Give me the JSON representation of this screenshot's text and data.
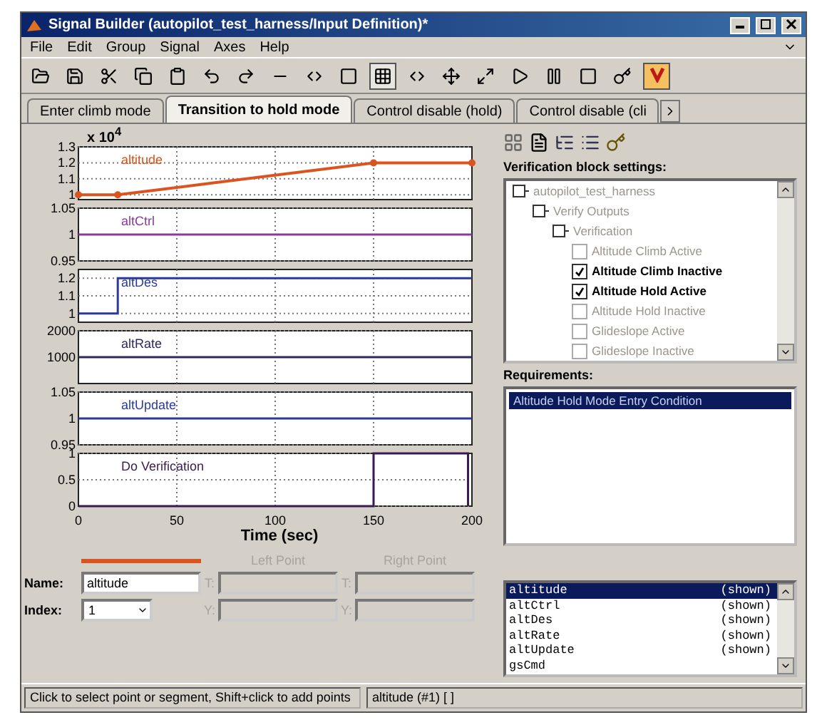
{
  "window": {
    "title": "Signal Builder (autopilot_test_harness/Input Definition)*"
  },
  "menu": [
    "File",
    "Edit",
    "Group",
    "Signal",
    "Axes",
    "Help"
  ],
  "tabs": [
    {
      "label": "Enter climb mode",
      "selected": false
    },
    {
      "label": "Transition to hold mode",
      "selected": true
    },
    {
      "label": "Control disable (hold)",
      "selected": false
    },
    {
      "label": "Control disable (cli",
      "selected": false
    }
  ],
  "plots": {
    "exponent": "x 10$^{4}$",
    "axes": [
      {
        "chart_data": {
          "type": "line",
          "grid": true,
          "xlim": [
            0,
            200
          ],
          "ylim": [
            0.97,
            1.3
          ],
          "yticks": [
            1,
            1.1,
            1.2,
            1.3
          ],
          "x": [
            0,
            20,
            150,
            200
          ],
          "series": [
            {
              "name": "altitude",
              "color": "#d9541e",
              "marker": true,
              "values": [
                1,
                1,
                1.2,
                1.2
              ]
            }
          ]
        }
      },
      {
        "chart_data": {
          "type": "line",
          "grid": true,
          "xlim": [
            0,
            200
          ],
          "ylim": [
            0.95,
            1.05
          ],
          "yticks": [
            0.95,
            1,
            1.05
          ],
          "x": [
            0,
            200
          ],
          "series": [
            {
              "name": "altCtrl",
              "color": "#8a3a9a",
              "values": [
                1,
                1
              ]
            }
          ]
        }
      },
      {
        "chart_data": {
          "type": "line",
          "grid": true,
          "xlim": [
            0,
            200
          ],
          "ylim": [
            0.95,
            1.25
          ],
          "yticks": [
            1,
            1.1,
            1.2
          ],
          "x": [
            0,
            20,
            20,
            200
          ],
          "series": [
            {
              "name": "altDes",
              "color": "#2a3a9a",
              "values": [
                1,
                1,
                1.2,
                1.2
              ]
            }
          ]
        }
      },
      {
        "chart_data": {
          "type": "line",
          "grid": true,
          "xlim": [
            0,
            200
          ],
          "ylim": [
            0,
            2000
          ],
          "yticks": [
            1000,
            2000
          ],
          "x": [
            0,
            200
          ],
          "series": [
            {
              "name": "altRate",
              "color": "#2a2a60",
              "values": [
                1000,
                1000
              ]
            }
          ]
        }
      },
      {
        "chart_data": {
          "type": "line",
          "grid": true,
          "xlim": [
            0,
            200
          ],
          "ylim": [
            0.95,
            1.05
          ],
          "yticks": [
            0.95,
            1,
            1.05
          ],
          "x": [
            0,
            200
          ],
          "series": [
            {
              "name": "altUpdate",
              "color": "#2a3aa0",
              "values": [
                1,
                1
              ]
            }
          ]
        }
      },
      {
        "chart_data": {
          "type": "line",
          "grid": true,
          "xlim": [
            0,
            200
          ],
          "ylim": [
            0,
            1
          ],
          "yticks": [
            0,
            0.5,
            1
          ],
          "xticks": [
            0,
            50,
            100,
            150,
            200
          ],
          "xlabel": "Time (sec)",
          "x": [
            0,
            150,
            150,
            198,
            198
          ],
          "series": [
            {
              "name": "Do Verification",
              "color": "#3a1a50",
              "values": [
                0,
                0,
                1,
                1,
                0
              ]
            }
          ]
        }
      }
    ]
  },
  "signal_editor": {
    "left_point": "Left Point",
    "right_point": "Right Point",
    "name_label": "Name:",
    "name": "altitude",
    "index_label": "Index:",
    "index": "1",
    "left_fields": [
      "T:",
      "Y:"
    ],
    "right_fields": [
      "T:",
      "Y:"
    ]
  },
  "verification": {
    "title": "Verification block settings:",
    "tree": [
      {
        "label": "autopilot_test_harness",
        "kind": "block",
        "children": [
          {
            "label": "Verify Outputs",
            "kind": "block",
            "children": [
              {
                "label": "Verification",
                "kind": "block",
                "children": [
                  {
                    "label": "Altitude Climb Active",
                    "kind": "check",
                    "checked": false
                  },
                  {
                    "label": "Altitude Climb Inactive",
                    "kind": "check",
                    "checked": true
                  },
                  {
                    "label": "Altitude Hold Active",
                    "kind": "check",
                    "checked": true
                  },
                  {
                    "label": "Altitude Hold Inactive",
                    "kind": "check",
                    "checked": false
                  },
                  {
                    "label": "Glideslope Active",
                    "kind": "check",
                    "checked": false
                  },
                  {
                    "label": "Glideslope Inactive",
                    "kind": "check",
                    "checked": false
                  }
                ]
              }
            ]
          }
        ]
      }
    ]
  },
  "requirements": {
    "title": "Requirements:",
    "items": [
      {
        "label": "Altitude Hold Mode Entry Condition",
        "selected": true
      }
    ]
  },
  "signal_list": [
    {
      "name": "altitude",
      "status": "(shown)",
      "selected": true
    },
    {
      "name": "altCtrl",
      "status": "(shown)",
      "selected": false
    },
    {
      "name": "altDes",
      "status": "(shown)",
      "selected": false
    },
    {
      "name": "altRate",
      "status": "(shown)",
      "selected": false
    },
    {
      "name": "altUpdate",
      "status": "(shown)",
      "selected": false
    },
    {
      "name": "gsCmd",
      "selected": false
    }
  ],
  "status_bar": [
    "Click to select point or segment, Shift+click to add points",
    "altitude (#1) [ ]"
  ]
}
